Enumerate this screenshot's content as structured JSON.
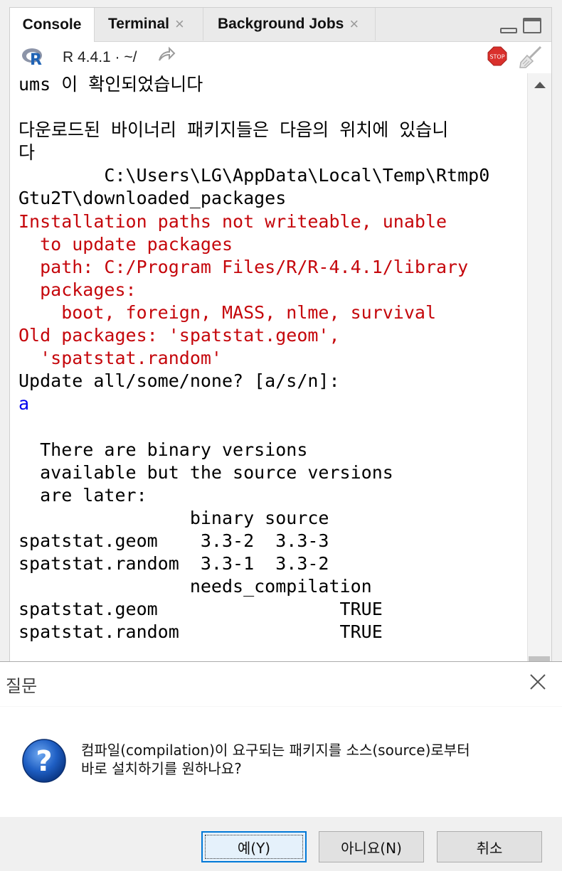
{
  "tabs": [
    {
      "label": "Console",
      "active": true,
      "closable": false
    },
    {
      "label": "Terminal",
      "active": false,
      "closable": true
    },
    {
      "label": "Background Jobs",
      "active": false,
      "closable": true
    }
  ],
  "tab_close_glyph": "×",
  "toolbar": {
    "r_version": "R 4.4.1 · ~/",
    "stop_label": "STOP",
    "icons": [
      "r-logo-icon",
      "forward-arrow-icon",
      "stop-icon",
      "broom-icon"
    ]
  },
  "console_lines": [
    {
      "text": "ums 이 확인되었습니다",
      "style": "normal"
    },
    {
      "text": "",
      "style": "normal"
    },
    {
      "text": "다운로드된 바이너리 패키지들은 다음의 위치에 있습니",
      "style": "normal"
    },
    {
      "text": "다",
      "style": "normal"
    },
    {
      "text": "        C:\\Users\\LG\\AppData\\Local\\Temp\\Rtmp0",
      "style": "normal"
    },
    {
      "text": "Gtu2T\\downloaded_packages",
      "style": "normal"
    },
    {
      "text": "Installation paths not writeable, unable",
      "style": "red"
    },
    {
      "text": "  to update packages",
      "style": "red"
    },
    {
      "text": "  path: C:/Program Files/R/R-4.4.1/library",
      "style": "red"
    },
    {
      "text": "  packages:",
      "style": "red"
    },
    {
      "text": "    boot, foreign, MASS, nlme, survival",
      "style": "red"
    },
    {
      "text": "Old packages: 'spatstat.geom',",
      "style": "red"
    },
    {
      "text": "  'spatstat.random'",
      "style": "red"
    },
    {
      "text": "Update all/some/none? [a/s/n]:",
      "style": "normal"
    },
    {
      "text": "a",
      "style": "blue"
    },
    {
      "text": "",
      "style": "normal"
    },
    {
      "text": "  There are binary versions",
      "style": "normal"
    },
    {
      "text": "  available but the source versions",
      "style": "normal"
    },
    {
      "text": "  are later:",
      "style": "normal"
    },
    {
      "text": "                binary source",
      "style": "normal"
    },
    {
      "text": "spatstat.geom    3.3-2  3.3-3",
      "style": "normal"
    },
    {
      "text": "spatstat.random  3.3-1  3.3-2",
      "style": "normal"
    },
    {
      "text": "                needs_compilation",
      "style": "normal"
    },
    {
      "text": "spatstat.geom                 TRUE",
      "style": "normal"
    },
    {
      "text": "spatstat.random               TRUE",
      "style": "normal"
    }
  ],
  "dialog": {
    "title": "질문",
    "message_line1": "컴파일(compilation)이 요구되는 패키지를 소스(source)로부터",
    "message_line2": "바로 설치하기를 원하나요?",
    "buttons": {
      "yes": "예(Y)",
      "no": "아니요(N)",
      "cancel": "취소"
    }
  },
  "colors": {
    "error_text": "#c5060b",
    "input_text": "#0000ee",
    "dialog_default_border": "#0078d7"
  }
}
